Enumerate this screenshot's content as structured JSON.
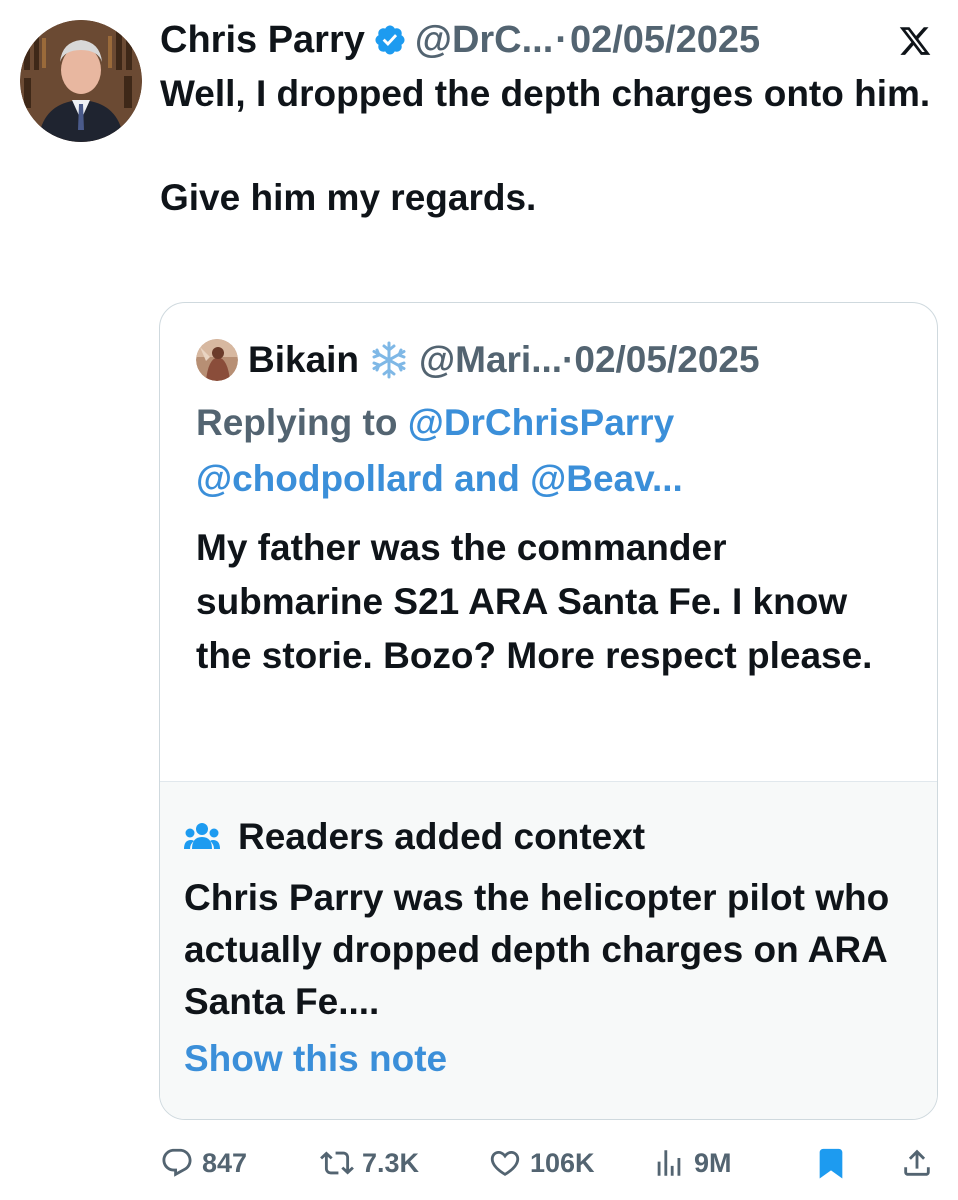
{
  "tweet": {
    "author_name": "Chris Parry",
    "handle": "@DrC...",
    "separator": "·",
    "date": "02/05/2025",
    "text": "Well, I dropped the depth charges onto him.\n\nGive him my regards."
  },
  "quoted": {
    "author_name": "Bikain",
    "handle": "@Mari...",
    "separator": "·",
    "date": "02/05/2025",
    "replying_prefix": "Replying to",
    "mention_1": "@DrChrisParry",
    "mention_2": "@chodpollard",
    "and_word": "and",
    "mention_3": "@Beav...",
    "text": "My father was the commander submarine S21 ARA Santa Fe. I know the storie. Bozo? More respect please.",
    "note": {
      "heading": "Readers added context",
      "body": "Chris Parry was the helicopter pilot who actually dropped depth charges on ARA Santa Fe....",
      "show_label": "Show this note"
    }
  },
  "actions": {
    "replies": "847",
    "retweets": "7.3K",
    "likes": "106K",
    "views": "9M"
  },
  "colors": {
    "verified_blue": "#1d9bf0",
    "link_blue": "#3b8fd9",
    "muted_gray": "#536471",
    "bookmark_blue": "#1d9bf0"
  },
  "icons": [
    "verified-badge-icon",
    "x-logo-icon",
    "snowflake-icon",
    "people-icon",
    "reply-icon",
    "retweet-icon",
    "like-icon",
    "views-icon",
    "bookmark-icon",
    "share-icon"
  ]
}
